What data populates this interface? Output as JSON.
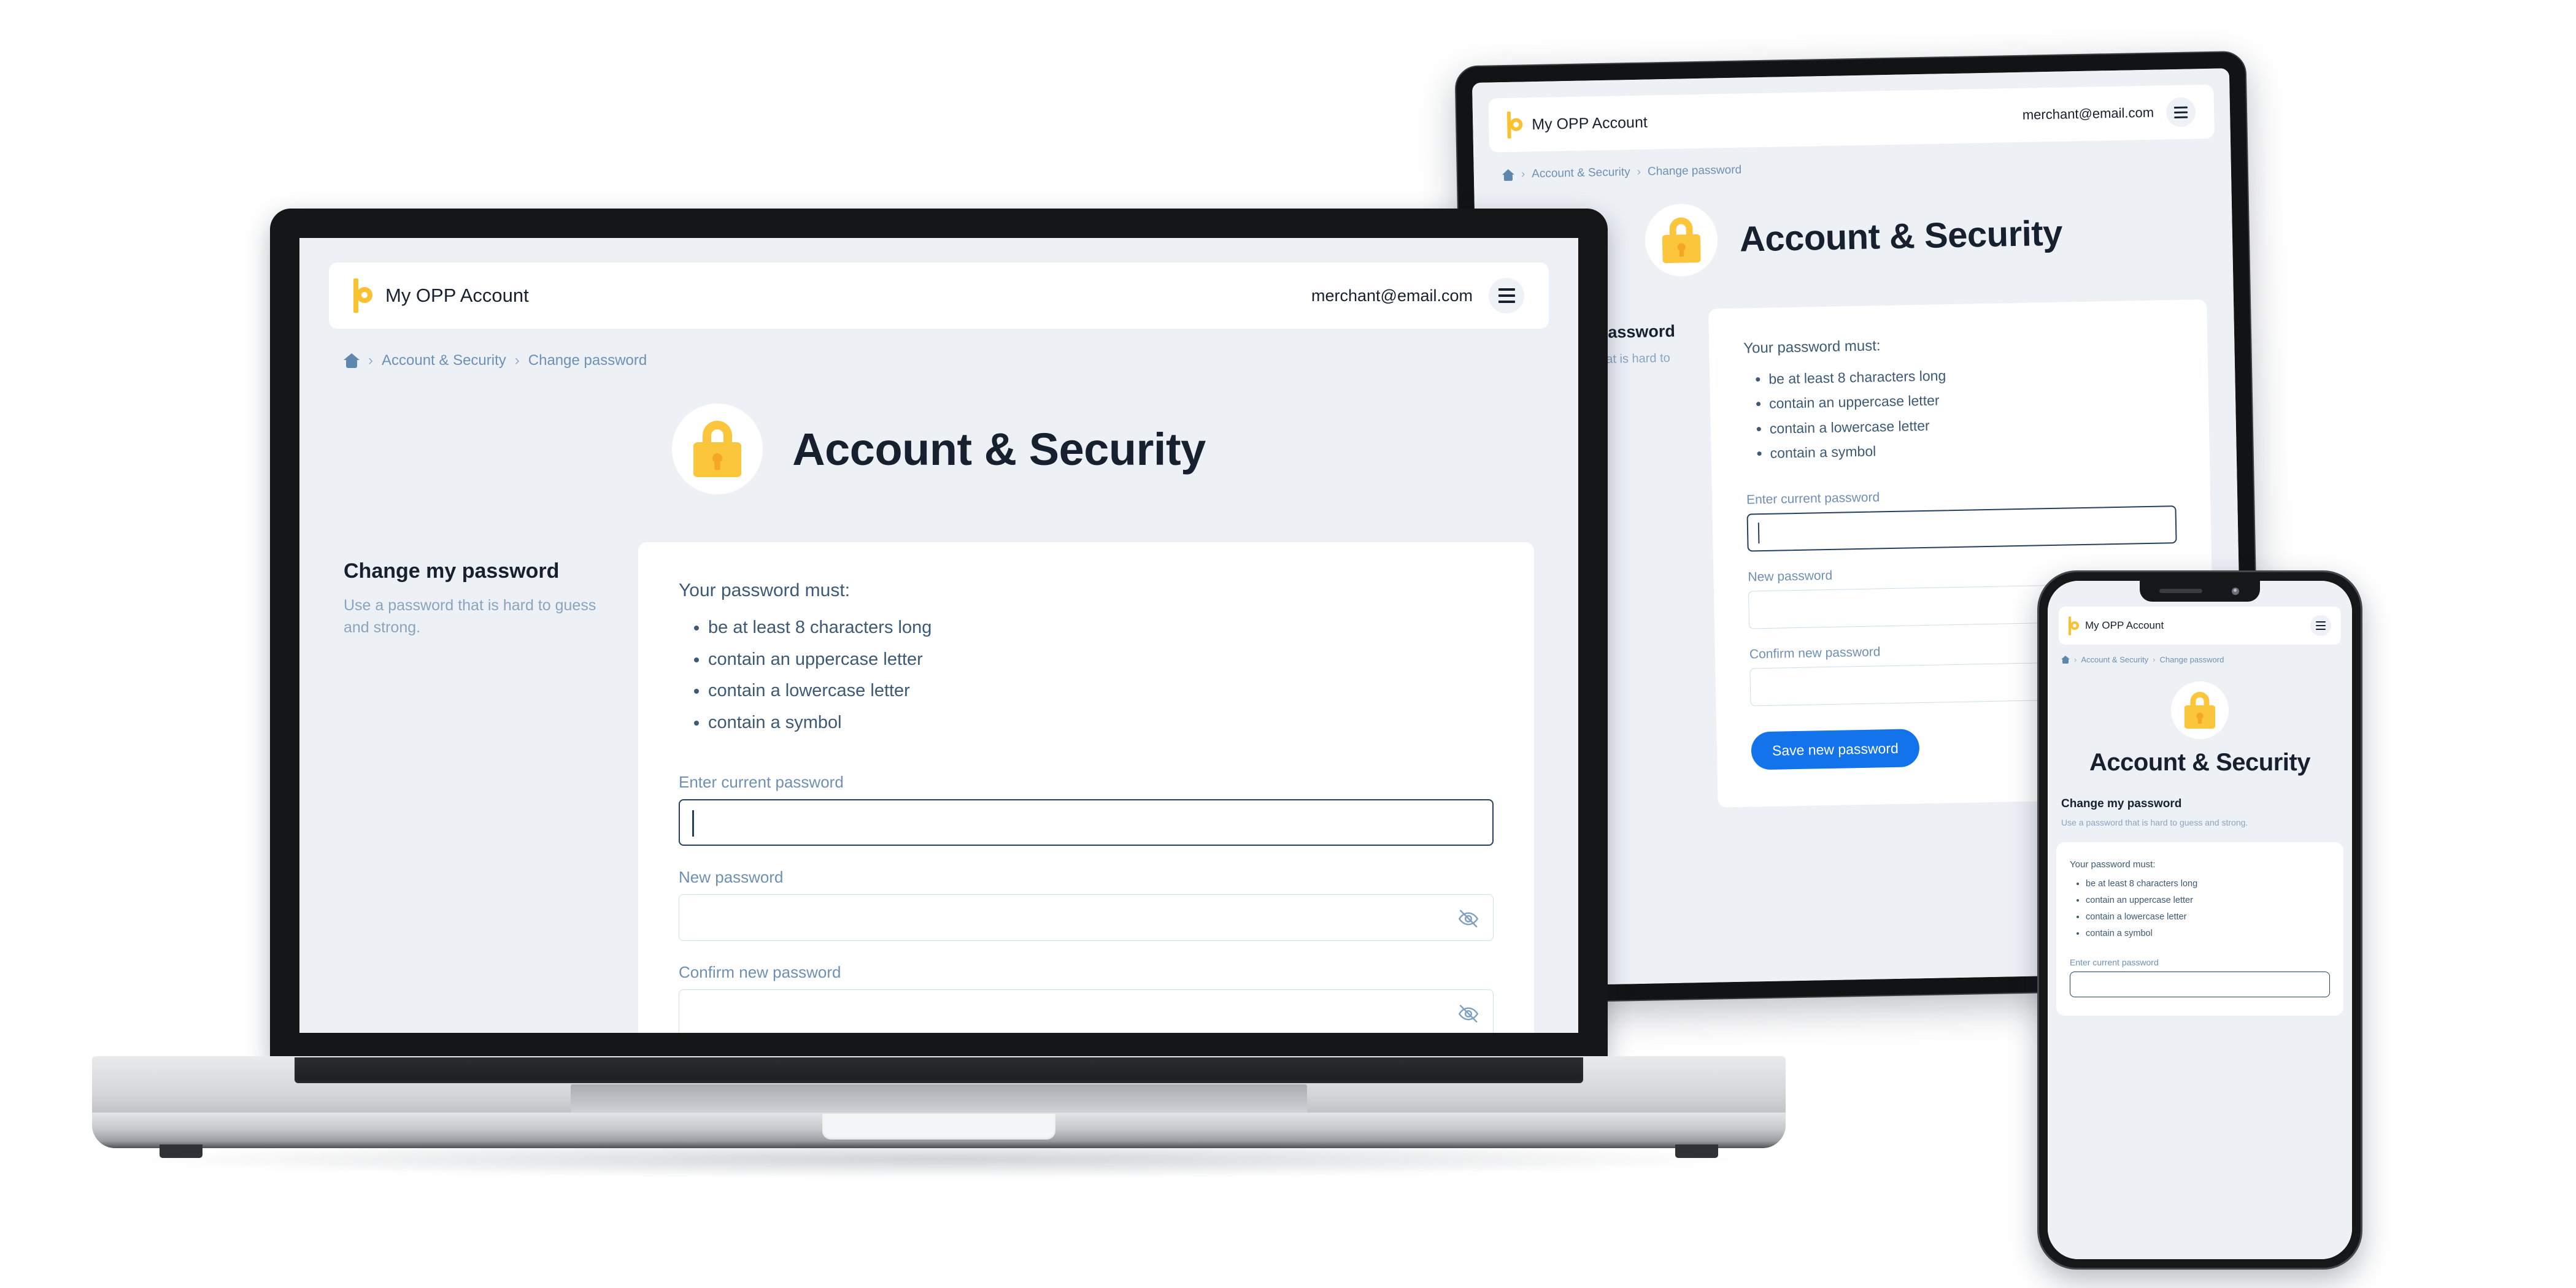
{
  "brand": {
    "logo_icon": "opp-b-logo-icon",
    "name": "My OPP Account"
  },
  "header": {
    "email": "merchant@email.com",
    "menu_icon": "hamburger-menu-icon"
  },
  "breadcrumb": {
    "home_icon": "home-icon",
    "separator": "›",
    "items": [
      "Account & Security",
      "Change password"
    ]
  },
  "hero": {
    "icon": "padlock-icon",
    "title": "Account & Security"
  },
  "sidebar": {
    "title": "Change my password",
    "subtitle": "Use a password that is hard to guess and strong."
  },
  "form": {
    "requirements_intro": "Your password must:",
    "requirements": [
      "be at least 8 characters long",
      "contain an uppercase letter",
      "contain a lowercase letter",
      "contain a symbol"
    ],
    "fields": [
      {
        "label": "Enter current password",
        "value": "",
        "focused": true,
        "toggle_icon": null
      },
      {
        "label": "New password",
        "value": "",
        "focused": false,
        "toggle_icon": "eye-off-icon"
      },
      {
        "label": "Confirm new password",
        "value": "",
        "focused": false,
        "toggle_icon": "eye-off-icon"
      }
    ],
    "submit_label": "Save new password"
  },
  "colors": {
    "page_background": "#edf1f6",
    "card_background": "#ffffff",
    "brand_yellow": "#f9c231",
    "lock_yellow": "#fcc63c",
    "primary_blue": "#1273eb",
    "heading_ink": "#17202e",
    "body_slate": "#3c5a75",
    "muted_slate": "#6e90b4",
    "focus_border": "#24405c",
    "idle_border": "#ccdced"
  },
  "devices": [
    {
      "name": "laptop",
      "label": "laptop-device"
    },
    {
      "name": "tablet",
      "label": "tablet-device"
    },
    {
      "name": "phone",
      "label": "phone-device"
    }
  ]
}
